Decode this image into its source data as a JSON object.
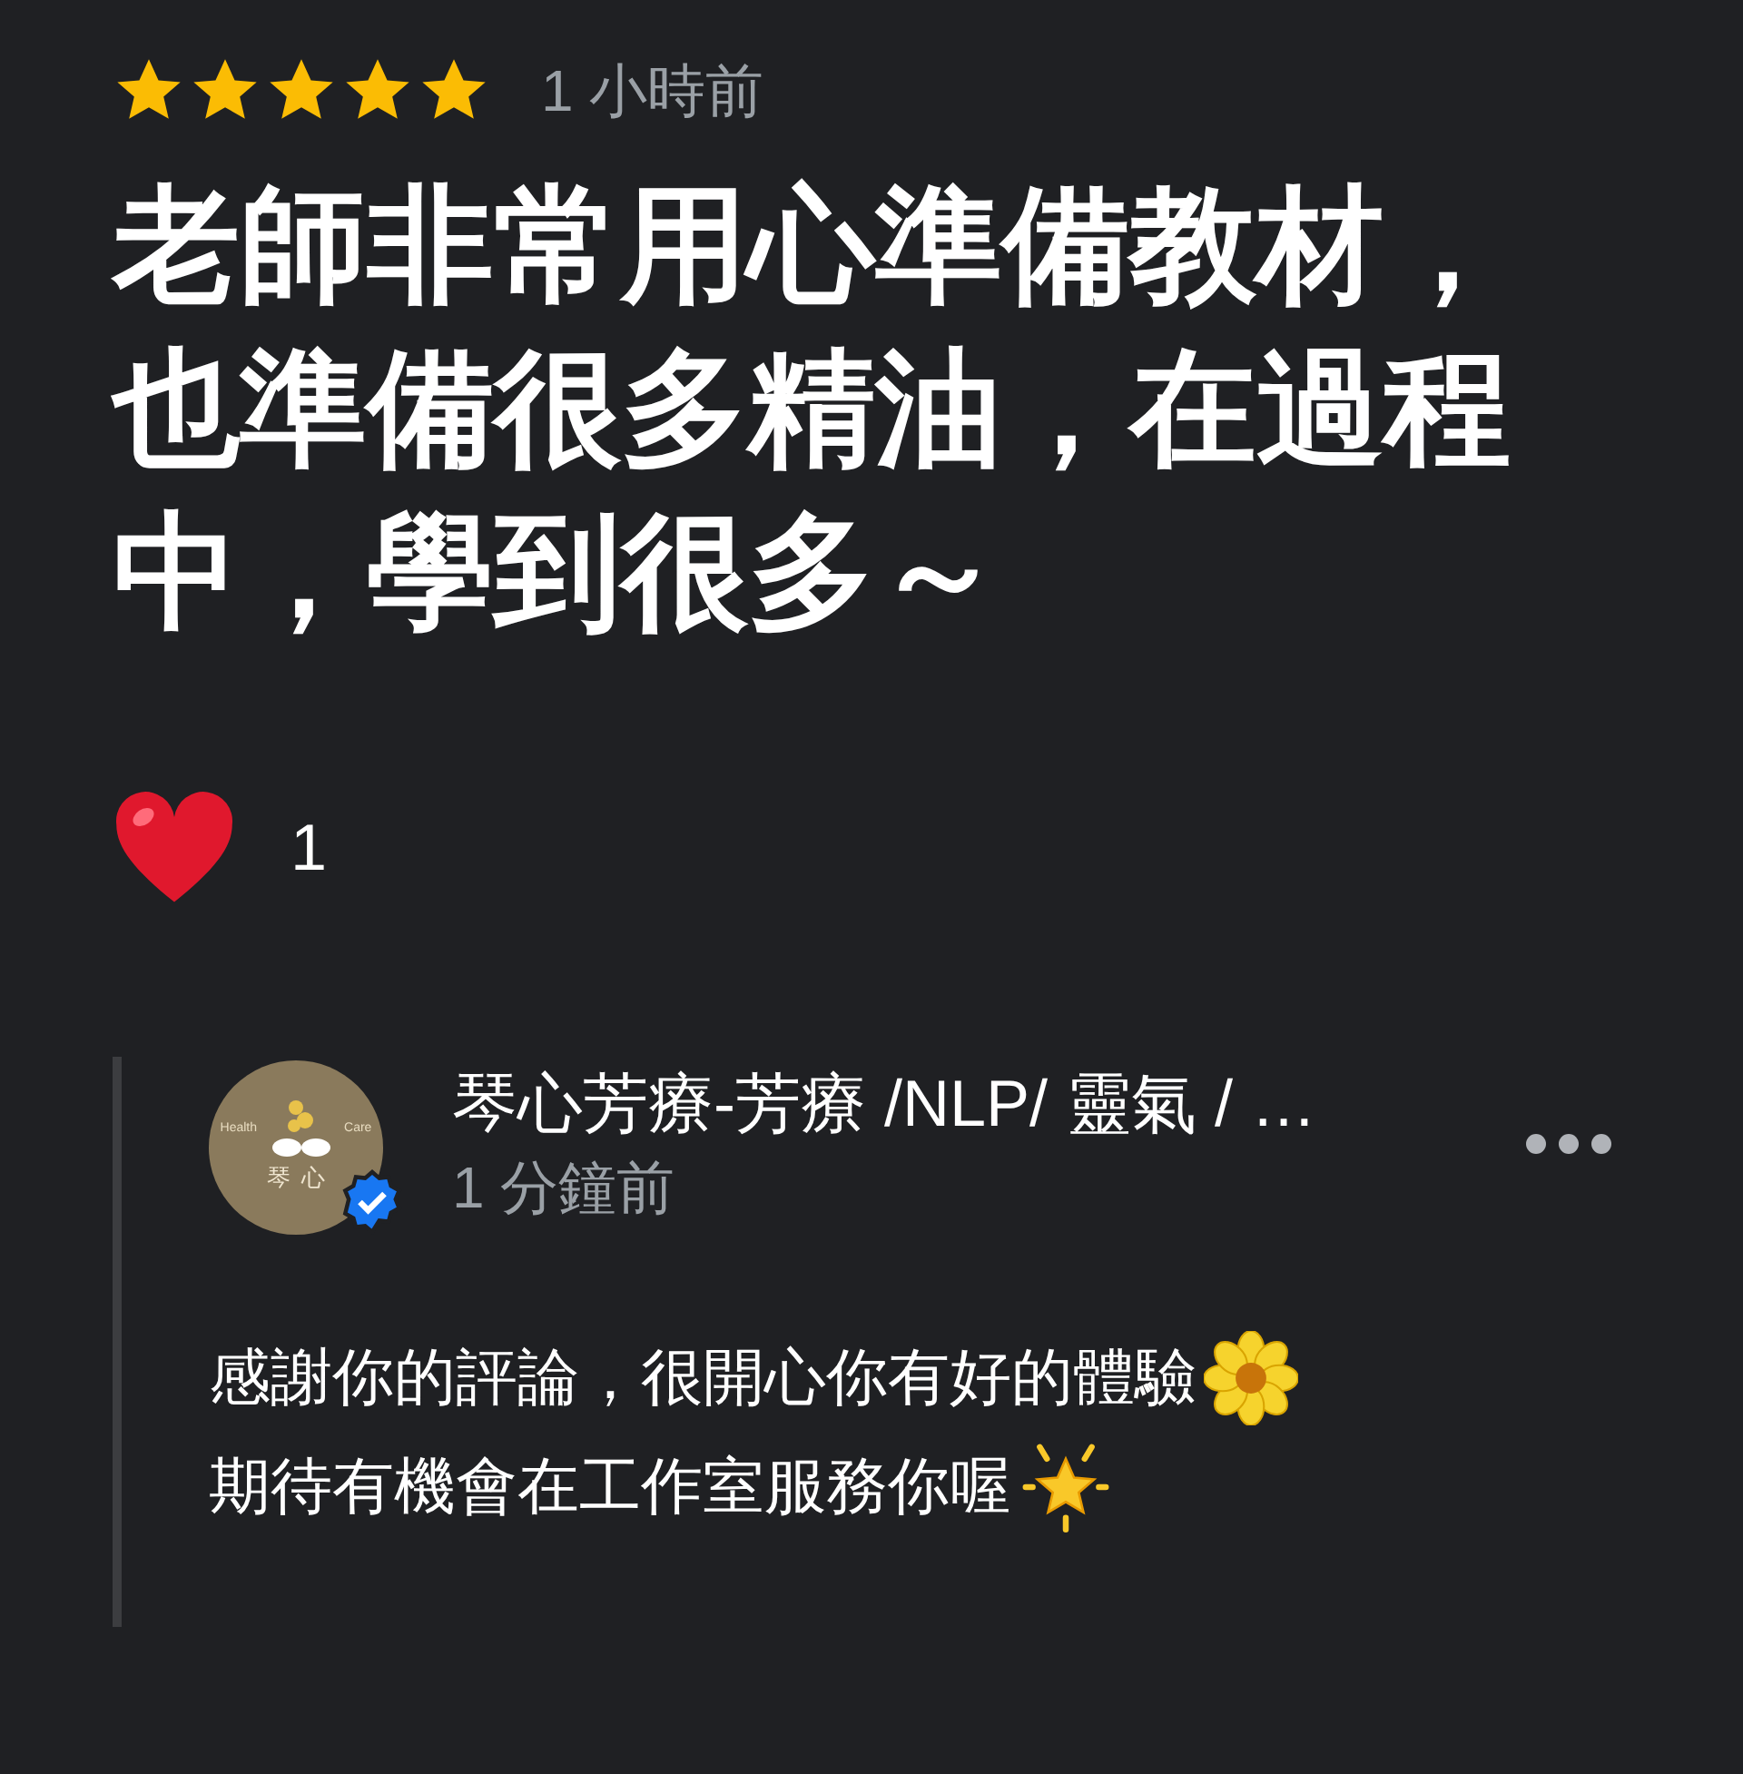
{
  "review": {
    "stars": 5,
    "time": "1 小時前",
    "text": "老師非常用心準備教材，也準備很多精油，在過程中，學到很多～"
  },
  "reactions": {
    "count": "1"
  },
  "reply": {
    "avatar": {
      "top_text": [
        "Health",
        "Care"
      ],
      "bottom_text": "琴心"
    },
    "author": "琴心芳療-芳療 /NLP/ 靈氣 / …",
    "verified": true,
    "time": "1 分鐘前",
    "lines": [
      {
        "text": "感謝你的評論，很開心你有好的體驗",
        "kind": "flower"
      },
      {
        "text": "期待有機會在工作室服務你喔",
        "kind": "star"
      }
    ]
  }
}
